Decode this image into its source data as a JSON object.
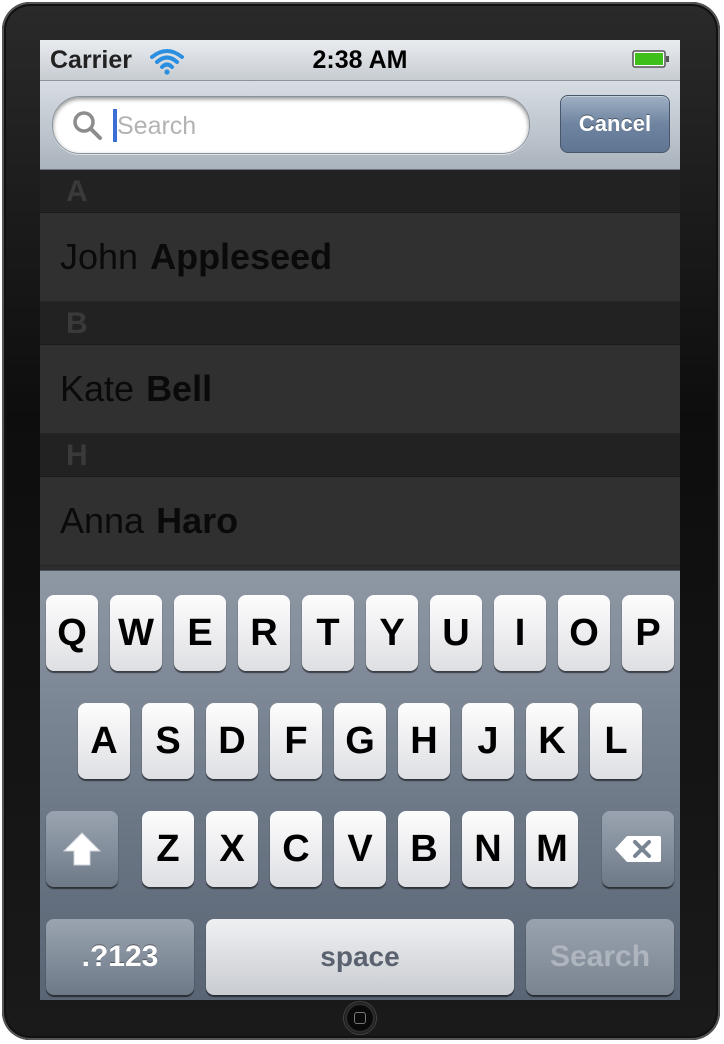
{
  "status_bar": {
    "carrier": "Carrier",
    "time": "2:38 AM"
  },
  "search": {
    "placeholder": "Search",
    "cancel_label": "Cancel"
  },
  "sections": [
    {
      "letter": "A",
      "rows": [
        {
          "first": "John",
          "last": "Appleseed"
        }
      ]
    },
    {
      "letter": "B",
      "rows": [
        {
          "first": "Kate",
          "last": "Bell"
        }
      ]
    },
    {
      "letter": "H",
      "rows": [
        {
          "first": "Anna",
          "last": "Haro"
        }
      ]
    }
  ],
  "keyboard": {
    "row1": [
      "Q",
      "W",
      "E",
      "R",
      "T",
      "Y",
      "U",
      "I",
      "O",
      "P"
    ],
    "row2": [
      "A",
      "S",
      "D",
      "F",
      "G",
      "H",
      "J",
      "K",
      "L"
    ],
    "row3": [
      "Z",
      "X",
      "C",
      "V",
      "B",
      "N",
      "M"
    ],
    "numbers_label": ".?123",
    "space_label": "space",
    "search_label": "Search"
  },
  "colors": {
    "battery": "#3fbf1a",
    "wifi": "#2a8fe0",
    "cursor": "#3b6fd6"
  }
}
